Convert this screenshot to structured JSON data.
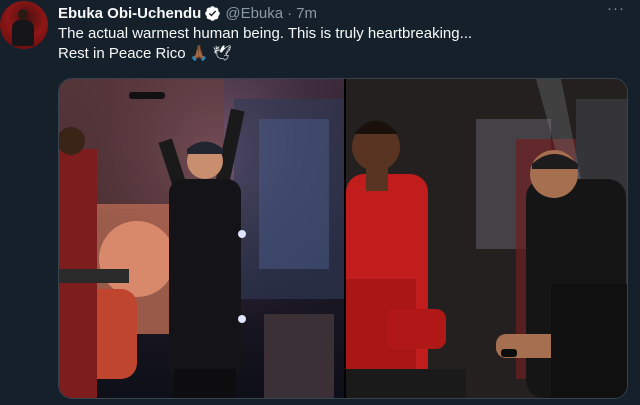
{
  "tweet": {
    "author_name": "Ebuka Obi-Uchendu",
    "handle": "@Ebuka",
    "separator": "·",
    "timestamp": "7m",
    "more_label": "···",
    "text_lines": [
      "The actual warmest human being. This is truly heartbreaking...",
      "Rest in Peace Rico 🙏🏾 🕊"
    ]
  },
  "media": {
    "photo_count": 2,
    "photos": [
      {
        "description_id": "photo-left"
      },
      {
        "description_id": "photo-right"
      }
    ]
  },
  "icons": {
    "verified": "verified-badge-icon",
    "more": "more-options-icon"
  },
  "colors": {
    "background": "#15202b",
    "verified": "#1d9bf0",
    "secondary_text": "#8b98a5",
    "primary_text": "#f7f9f9"
  }
}
